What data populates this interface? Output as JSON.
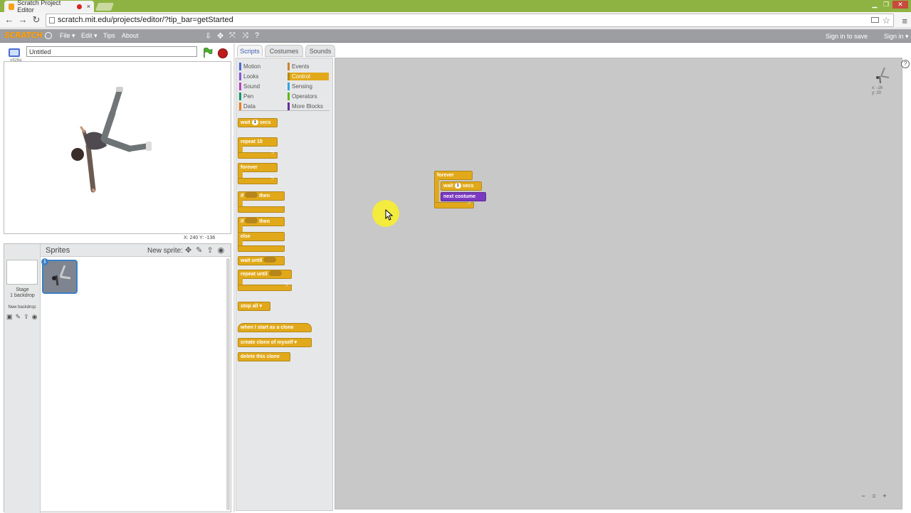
{
  "browser": {
    "tab_title": "Scratch Project Editor",
    "tab_close": "×",
    "url": "scratch.mit.edu/projects/editor/?tip_bar=getStarted",
    "back_icon": "←",
    "forward_icon": "→",
    "reload_icon": "↻",
    "star_icon": "☆",
    "menu_icon": "≡"
  },
  "scratch_menu": {
    "logo": "SCRATCH",
    "items": [
      {
        "label": "File ▾"
      },
      {
        "label": "Edit ▾"
      },
      {
        "label": "Tips"
      },
      {
        "label": "About"
      }
    ],
    "tools": [
      "⇩",
      "✥",
      "⤧",
      "⤨",
      "?"
    ],
    "sign_in_save": "Sign in to save",
    "sign_in": "Sign in ▾"
  },
  "stage": {
    "version": "v426a",
    "project_title": "Untitled",
    "coords": "X: 240  Y: -136"
  },
  "sprites": {
    "header": "Sprites",
    "new_sprite_label": "New sprite:",
    "new_sprite_icons": [
      "✥",
      "✎",
      "⇪",
      "◉"
    ],
    "stage_label_1": "Stage",
    "stage_label_2": "1 backdrop",
    "new_backdrop_label": "New backdrop:",
    "backdrop_icons": [
      "▣",
      "✎",
      "⇪",
      "◉"
    ],
    "info_badge": "i"
  },
  "tabs": [
    {
      "label": "Scripts",
      "active": true
    },
    {
      "label": "Costumes",
      "active": false
    },
    {
      "label": "Sounds",
      "active": false
    }
  ],
  "categories": [
    {
      "label": "Motion",
      "color": "#4a6cd4",
      "selected": false
    },
    {
      "label": "Events",
      "color": "#c88330",
      "selected": false
    },
    {
      "label": "Looks",
      "color": "#8a55d7",
      "selected": false
    },
    {
      "label": "Control",
      "color": "#e1a91a",
      "selected": true
    },
    {
      "label": "Sound",
      "color": "#bb42c3",
      "selected": false
    },
    {
      "label": "Sensing",
      "color": "#2ca5e2",
      "selected": false
    },
    {
      "label": "Pen",
      "color": "#0e9a6c",
      "selected": false
    },
    {
      "label": "Operators",
      "color": "#5cb712",
      "selected": false
    },
    {
      "label": "Data",
      "color": "#ee7d16",
      "selected": false
    },
    {
      "label": "More Blocks",
      "color": "#632d99",
      "selected": false
    }
  ],
  "palette_blocks": {
    "wait_prefix": "wait",
    "wait_num": "1",
    "wait_suffix": "secs",
    "repeat_label": "repeat",
    "repeat_num": "10",
    "forever_label": "forever",
    "if_then_if": "if",
    "if_then_then": "then",
    "if_else_if": "if",
    "if_else_then": "then",
    "if_else_else": "else",
    "wait_until": "wait until",
    "repeat_until": "repeat until",
    "stop": "stop  all ▾",
    "clone_hat": "when I start as a clone",
    "create_clone": "create clone of  myself ▾",
    "delete_clone": "delete this clone"
  },
  "script": {
    "forever_label": "forever",
    "wait_prefix": "wait",
    "wait_num": "1",
    "wait_suffix": "secs",
    "next_costume": "next costume"
  },
  "corner_sprite_coords": "x: -16\ny: 20",
  "zoom_icons": [
    "−",
    "=",
    "+"
  ],
  "colors": {
    "control": "#e1a91a",
    "looks": "#7b39c1",
    "script_area": "#c8c8c8"
  }
}
